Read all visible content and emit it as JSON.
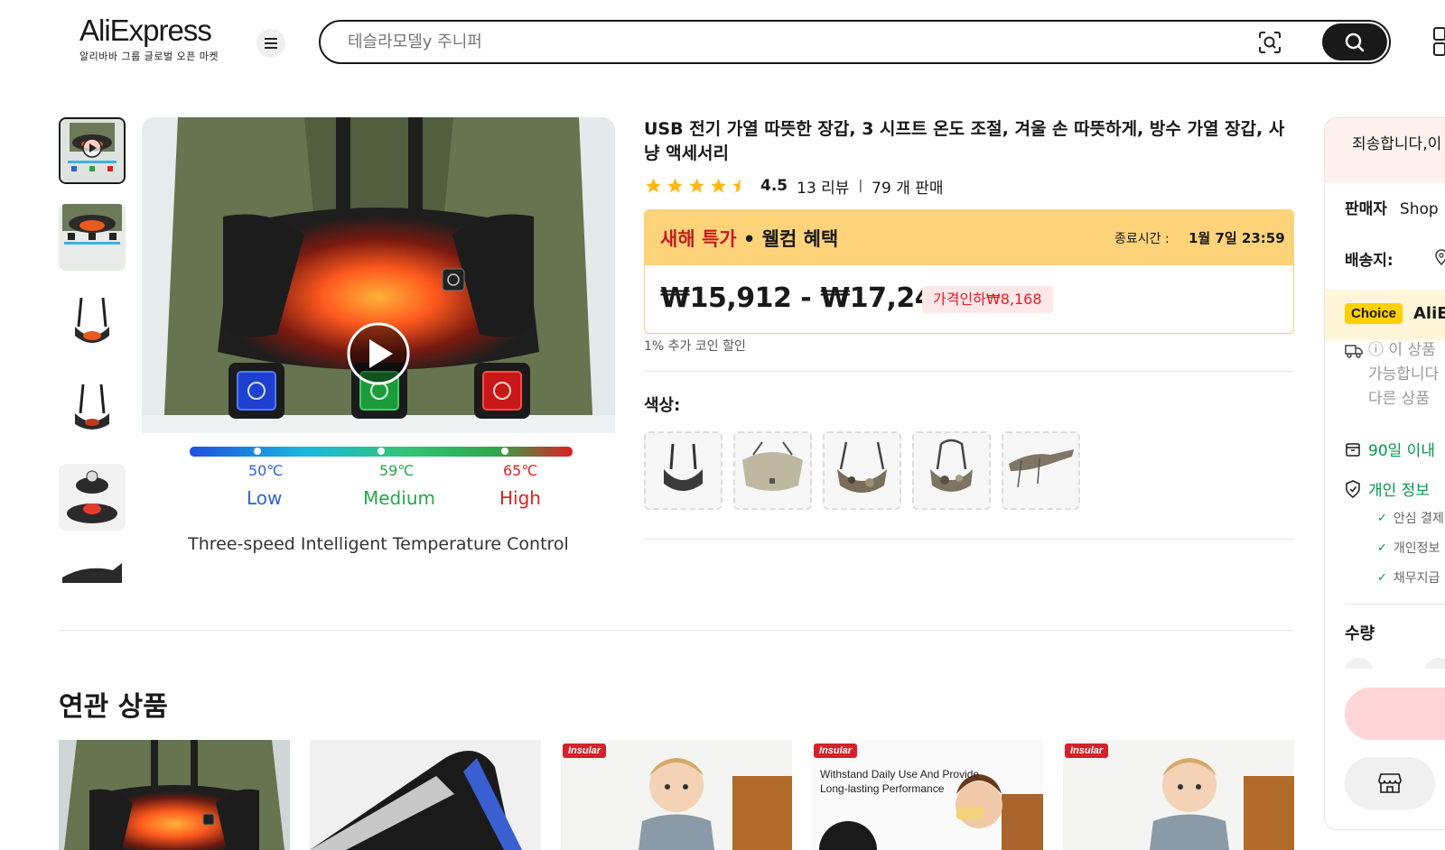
{
  "header": {
    "logo_text": "AliExpress",
    "logo_tagline": "알리바바 그룹 글로벌 오픈 마켓",
    "search_placeholder": "테슬라모델y 주니퍼"
  },
  "product": {
    "title": "USB 전기 가열 따뜻한 장갑, 3 시프트 온도 조절, 겨울 손 따뜻하게, 방수 가열 장갑, 사냥 액세서리",
    "rating": "4.5",
    "reviews": "13 리뷰",
    "sold": "79 개 판매",
    "promo": {
      "title": "새해 특가",
      "dot": " • ",
      "subtitle": "웰컴 혜택",
      "timer_label": "종료시간 :",
      "timer": "1월 7일 23:59"
    },
    "price": "₩15,912 - ₩17,246",
    "discount": "가격인하₩8,168",
    "coin_note": "1% 추가 코인 할인",
    "color_label": "색상:"
  },
  "main_image": {
    "temps": [
      "50℃",
      "59℃",
      "65℃"
    ],
    "levels": [
      "Low",
      "Medium",
      "High"
    ],
    "caption": "Three-speed Intelligent Temperature Control",
    "colors": {
      "low": "#2f63d8",
      "medium": "#27a64a",
      "high": "#e0201f"
    }
  },
  "related": {
    "title": "연관 상품",
    "tag": "Insular",
    "caption_line1": "Withstand Daily Use And Provide",
    "caption_line2": "Long-lasting Performance"
  },
  "side": {
    "alert": "죄송합니다,이",
    "seller_label": "판매자",
    "seller_value": "Shop",
    "ship_label": "배송지:",
    "choice_badge": "Choice",
    "choice_text": "AliE",
    "note_line1": "ⓘ 이 상품",
    "note_line2": "가능합니다",
    "note_line3": "다른 상품",
    "return_text": "90일 이내",
    "privacy_text": "개인 정보",
    "checks": [
      "안심 결제",
      "개인정보",
      "채무지급"
    ],
    "qty_label": "수량"
  },
  "colors": {
    "accent_red": "#e0202a",
    "promo_yellow": "#ffd37a",
    "green": "#00994c",
    "star": "#fdb813"
  }
}
